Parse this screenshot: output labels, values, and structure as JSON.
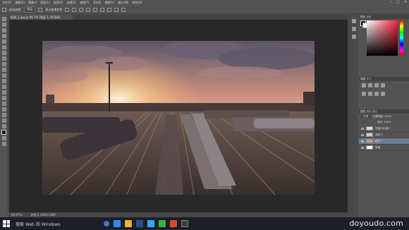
{
  "menu": {
    "items": [
      "文件(F)",
      "编辑(E)",
      "图像(I)",
      "图层(L)",
      "类型(Y)",
      "选择(S)",
      "滤镜(T)",
      "3D(D)",
      "视图(V)",
      "窗口(W)",
      "帮助(H)"
    ]
  },
  "options_bar": {
    "auto_select_label": "自动选择:",
    "layer_label": "图层",
    "show_transform_label": "显示变换控件"
  },
  "document": {
    "tab_label": "新建_1.jpg @ 66.7% (图层 1, RGB/8)"
  },
  "status": {
    "zoom": "66.67%",
    "doc_info": "文档:2.25M/4.50M"
  },
  "panels": {
    "color_tab": "颜色",
    "swatches_tab": "色板",
    "adjust_tab": "调整",
    "styles_tab": "样式",
    "layers_tab": "图层",
    "channels_tab": "通道",
    "paths_tab": "路径",
    "blend_mode": "正常",
    "opacity_label": "不透明度: 100%",
    "fill_label": "填充: 100%",
    "layers": [
      {
        "name": "亮度/对比度 1",
        "selected": false
      },
      {
        "name": "曲线 1",
        "selected": false
      },
      {
        "name": "图层 1",
        "selected": true
      },
      {
        "name": "背景",
        "selected": false
      }
    ]
  },
  "taskbar": {
    "search_text": "搜索 Web 和 Windows",
    "watermark": "doyoudo.com"
  },
  "colors": {
    "ui_bg": "#535353",
    "canvas_bg": "#282828",
    "selection": "#6a7a94",
    "taskbar": "#1c1f26"
  }
}
